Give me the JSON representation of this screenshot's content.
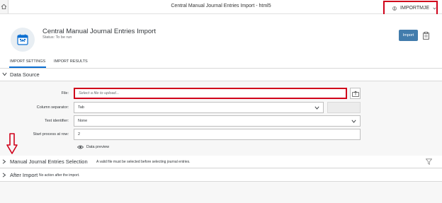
{
  "shell": {
    "title": "Central Manual Journal Entries Import - html5",
    "user": "IMPORTMJE",
    "home_icon": "home-icon",
    "user_icon": "user-circle-icon",
    "menu_icon": "chevron-down-icon"
  },
  "header": {
    "title": "Central Manual Journal Entries Import",
    "status": "Status: To be run",
    "import_label": "Import"
  },
  "tabs": [
    {
      "label": "IMPORT SETTINGS",
      "selected": true
    },
    {
      "label": "IMPORT RESULTS",
      "selected": false
    }
  ],
  "data_source": {
    "title": "Data Source",
    "file_label": "File:",
    "file_placeholder": "Select a file to upload...",
    "column_separator_label": "Column separator:",
    "column_separator_value": "Tab",
    "text_identifier_label": "Text identifier:",
    "text_identifier_value": "None",
    "start_row_label": "Start process at row:",
    "start_row_value": "2",
    "preview_label": "Data preview"
  },
  "manual_selection": {
    "title": "Manual Journal Entries Selection",
    "note": "A valid file must be selected before selecting journal entries."
  },
  "after_import": {
    "title": "After Import",
    "note": "No action after the import."
  },
  "colors": {
    "accent": "#0a6ed1",
    "button": "#427cac",
    "highlight": "#d0021b"
  }
}
